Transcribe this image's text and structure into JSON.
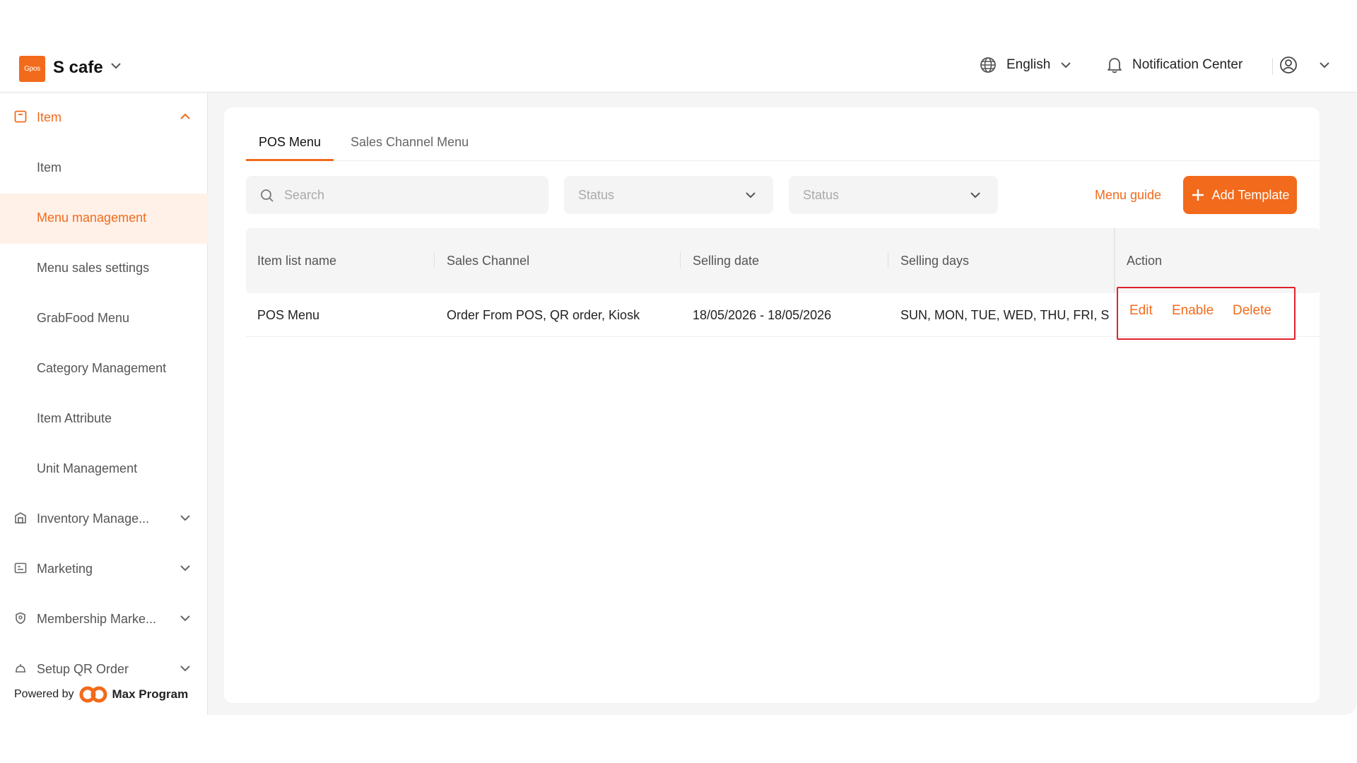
{
  "header": {
    "logo_text": "Gpos",
    "store_name": "S cafe",
    "language": "English",
    "notification": "Notification Center"
  },
  "sidebar": {
    "groups": [
      {
        "label": "Item",
        "icon": "item-icon",
        "expanded": true
      },
      {
        "label": "Inventory Manage...",
        "icon": "inventory-icon"
      },
      {
        "label": "Marketing",
        "icon": "marketing-icon"
      },
      {
        "label": "Membership Marke...",
        "icon": "membership-icon"
      },
      {
        "label": "Setup QR Order",
        "icon": "qr-order-icon"
      }
    ],
    "items": [
      {
        "label": "Item"
      },
      {
        "label": "Menu management",
        "selected": true
      },
      {
        "label": "Menu sales settings"
      },
      {
        "label": "GrabFood Menu"
      },
      {
        "label": "Category Management"
      },
      {
        "label": "Item Attribute"
      },
      {
        "label": "Unit Management"
      }
    ],
    "powered_by": "Powered by",
    "brand": "Max Program"
  },
  "tabs": [
    {
      "label": "POS Menu",
      "active": true
    },
    {
      "label": "Sales Channel Menu"
    }
  ],
  "filters": {
    "search_placeholder": "Search",
    "status1_placeholder": "Status",
    "status2_placeholder": "Status",
    "menu_guide": "Menu guide",
    "add_template": "Add Template"
  },
  "table": {
    "columns": [
      "Item list name",
      "Sales Channel",
      "Selling date",
      "Selling days",
      "Action"
    ],
    "rows": [
      {
        "name": "POS Menu",
        "channel": "Order From POS, QR order, Kiosk",
        "date": "18/05/2026 - 18/05/2026",
        "days": "SUN, MON, TUE, WED, THU, FRI, S",
        "actions": [
          "Edit",
          "Enable",
          "Delete"
        ]
      }
    ]
  },
  "colors": {
    "accent": "#f26a1b",
    "highlight_box": "#e0212b"
  }
}
